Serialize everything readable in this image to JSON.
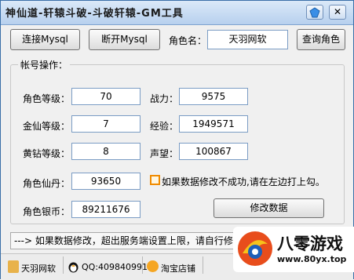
{
  "window": {
    "title": "神仙道-轩辕斗破-斗破轩辕-GM工具",
    "minimize_icon": "gem-icon",
    "close_glyph": "✕"
  },
  "toolbar": {
    "connect_label": "连接Mysql",
    "disconnect_label": "断开Mysql",
    "role_name_label": "角色名：",
    "role_name_value": "天羽网软",
    "query_label": "查询角色"
  },
  "account": {
    "group_title": "帐号操作：",
    "fields": {
      "level": {
        "label": "角色等级：",
        "value": "70"
      },
      "power": {
        "label": "战力：",
        "value": "9575"
      },
      "immortal_level": {
        "label": "金仙等级：",
        "value": "7"
      },
      "exp": {
        "label": "经验：",
        "value": "1949571"
      },
      "diamond_level": {
        "label": "黄钻等级：",
        "value": "8"
      },
      "prestige": {
        "label": "声望：",
        "value": "100867"
      },
      "pill": {
        "label": "角色仙丹：",
        "value": "93650"
      },
      "silver": {
        "label": "角色银币：",
        "value": "89211676"
      }
    },
    "checkbox_label": "如果数据修改不成功,请在左边打上勾。",
    "modify_label": "修改数据"
  },
  "notice": "---> 如果数据修改，超出服务端设置上限，请自行修改",
  "statusbar": {
    "name": "天羽网软",
    "qq": "QQ:409840991",
    "shop": "淘宝店铺"
  },
  "watermark": {
    "brand": "八零游戏",
    "url": "www.80yx.top"
  },
  "colors": {
    "title_bg": "#c7dbf3",
    "field_border": "#7a9cc4",
    "accent_orange": "#f08a00",
    "brand_blue": "#1e5fb8"
  }
}
